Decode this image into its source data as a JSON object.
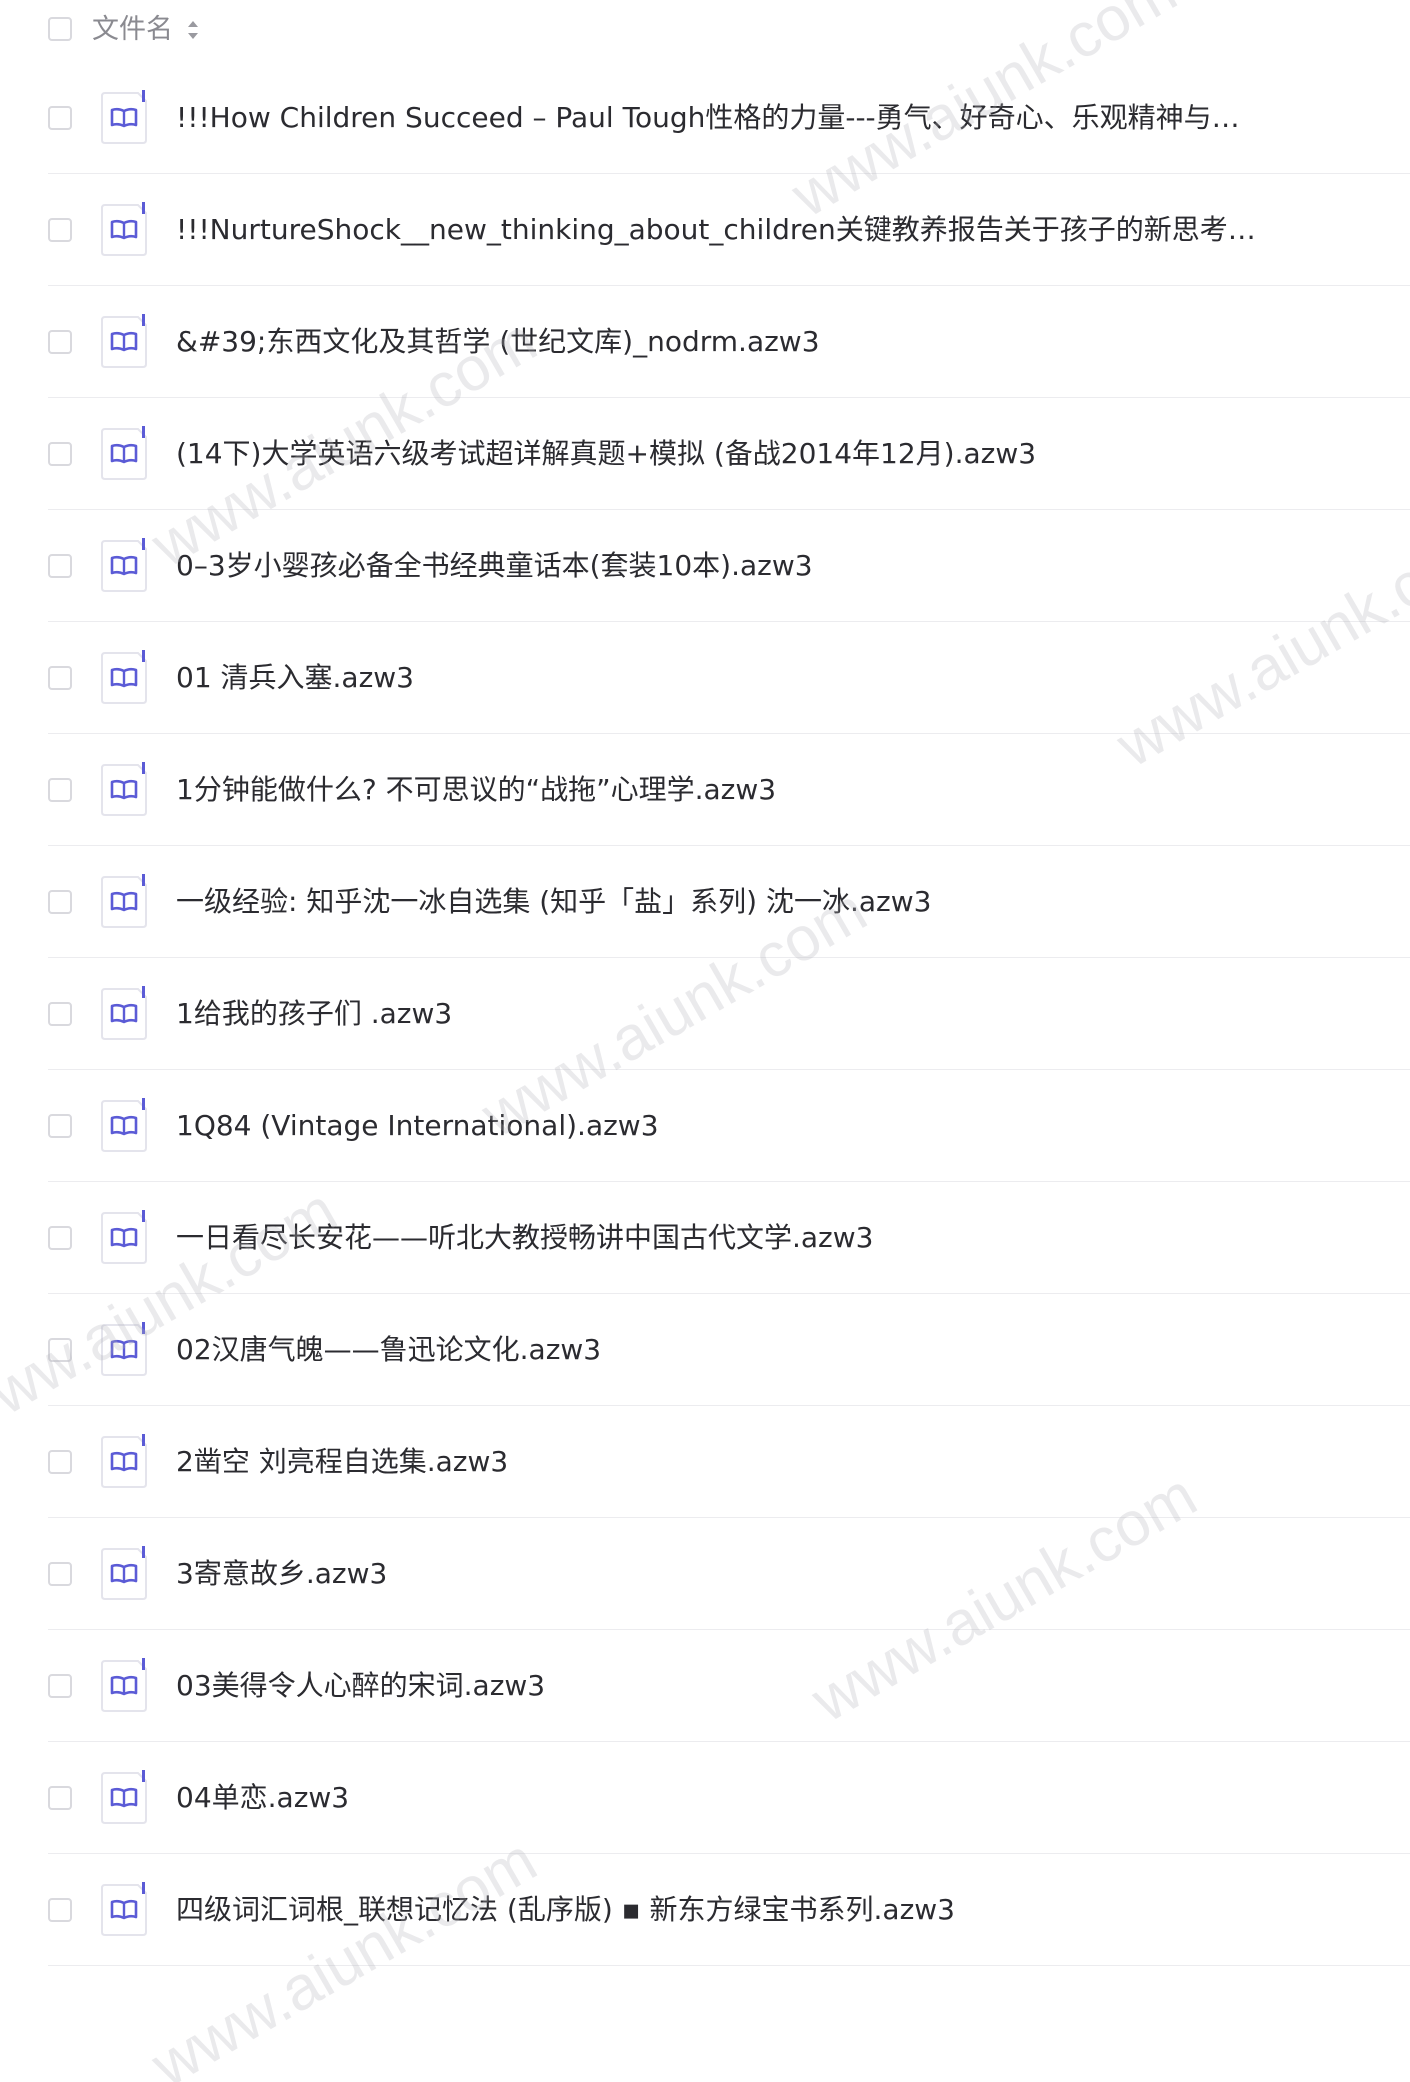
{
  "header": {
    "column_label": "文件名"
  },
  "files": [
    {
      "name": "!!!How Children Succeed – Paul Tough性格的力量---勇气、好奇心、乐观精神与…"
    },
    {
      "name": "!!!NurtureShock__new_thinking_about_children关键教养报告关于孩子的新思考.az…"
    },
    {
      "name": "&#39;东西文化及其哲学 (世纪文库)_nodrm.azw3"
    },
    {
      "name": "(14下)大学英语六级考试超详解真题+模拟 (备战2014年12月).azw3"
    },
    {
      "name": "0–3岁小婴孩必备全书经典童话本(套装10本).azw3"
    },
    {
      "name": "01 清兵入塞.azw3"
    },
    {
      "name": "1分钟能做什么? 不可思议的“战拖”心理学.azw3"
    },
    {
      "name": "一级经验: 知乎沈一冰自选集 (知乎「盐」系列) 沈一冰.azw3"
    },
    {
      "name": "1给我的孩子们 .azw3"
    },
    {
      "name": "1Q84 (Vintage International).azw3"
    },
    {
      "name": "一日看尽长安花——听北大教授畅讲中国古代文学.azw3"
    },
    {
      "name": "02汉唐气魄——鲁迅论文化.azw3"
    },
    {
      "name": "2凿空 刘亮程自选集.azw3"
    },
    {
      "name": "3寄意故乡.azw3"
    },
    {
      "name": "03美得令人心醉的宋词.azw3"
    },
    {
      "name": "04单恋.azw3"
    },
    {
      "name": "四级词汇词根_联想记忆法 (乱序版) ▪ 新东方绿宝书系列.azw3"
    }
  ],
  "watermark": "www.aiunk.com",
  "colors": {
    "icon_accent": "#5b5bd6",
    "text": "#2b2b30",
    "muted": "#8a8a90",
    "divider": "#ececef"
  }
}
